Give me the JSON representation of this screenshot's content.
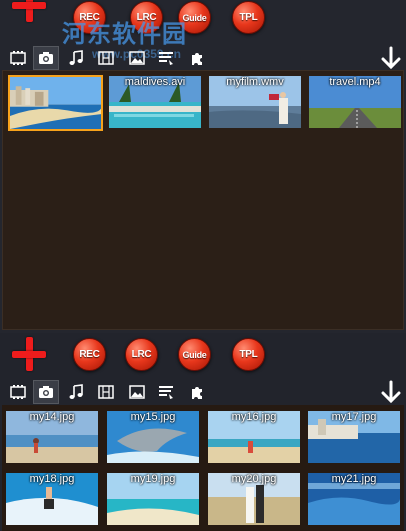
{
  "toolbar": {
    "rec_label": "REC",
    "lrc_label": "LRC",
    "guide_label": "Guide",
    "tpl_label": "TPL"
  },
  "tabs": {
    "icons": [
      "video-icon",
      "camera-icon",
      "music-icon",
      "film-strip-icon",
      "image-icon",
      "text-lines-icon",
      "puzzle-icon"
    ],
    "top_active": "camera-icon",
    "bottom_active": "camera-icon"
  },
  "watermark": {
    "title": "河东软件园",
    "url": "www.pc0359.cn"
  },
  "video_panel": {
    "items": [
      {
        "caption": "",
        "selected": true
      },
      {
        "caption": "maldives.avi",
        "selected": false
      },
      {
        "caption": "myfilm.wmv",
        "selected": false
      },
      {
        "caption": "travel.mp4",
        "selected": false
      }
    ]
  },
  "photo_panel": {
    "items": [
      {
        "caption": "my14.jpg"
      },
      {
        "caption": "my15.jpg"
      },
      {
        "caption": "my16.jpg"
      },
      {
        "caption": "my17.jpg"
      },
      {
        "caption": "my18.jpg"
      },
      {
        "caption": "my19.jpg"
      },
      {
        "caption": "my20.jpg"
      },
      {
        "caption": "my21.jpg"
      }
    ]
  },
  "colors": {
    "accent_red": "#ee1c1c",
    "selection": "#f7a21b",
    "panel_bg": "#2b1f17"
  }
}
